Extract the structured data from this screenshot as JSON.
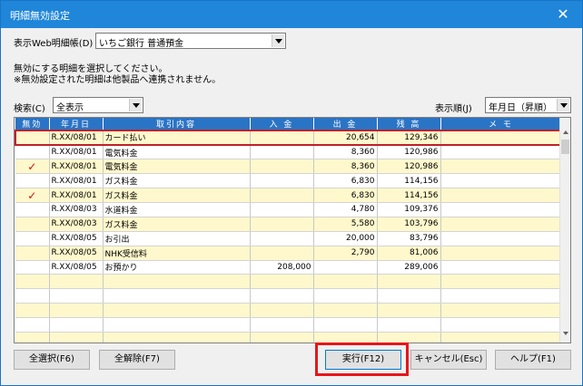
{
  "window": {
    "title": "明細無効設定",
    "close": "✕"
  },
  "account": {
    "label": "表示Web明細帳(D)",
    "value": "いちご銀行 普通預金"
  },
  "notes": [
    "無効にする明細を選択してください。",
    "※無効設定された明細は他製品へ連携されません。"
  ],
  "search": {
    "label": "検索(C)",
    "value": "全表示"
  },
  "sort": {
    "label": "表示順(J)",
    "value": "年月日（昇順）"
  },
  "table": {
    "columns": [
      "無効",
      "年月日",
      "取引内容",
      "入 金",
      "出 金",
      "残 高",
      "メ モ"
    ],
    "rows": [
      {
        "invalid": "",
        "date": "R.XX/08/01",
        "desc": "カード払い",
        "in": "",
        "out": "20,654",
        "balance": "129,346",
        "memo": ""
      },
      {
        "invalid": "",
        "date": "R.XX/08/01",
        "desc": "電気料金",
        "in": "",
        "out": "8,360",
        "balance": "120,986",
        "memo": ""
      },
      {
        "invalid": "✓",
        "date": "R.XX/08/01",
        "desc": "電気料金",
        "in": "",
        "out": "8,360",
        "balance": "120,986",
        "memo": ""
      },
      {
        "invalid": "",
        "date": "R.XX/08/01",
        "desc": "ガス料金",
        "in": "",
        "out": "6,830",
        "balance": "114,156",
        "memo": ""
      },
      {
        "invalid": "✓",
        "date": "R.XX/08/01",
        "desc": "ガス料金",
        "in": "",
        "out": "6,830",
        "balance": "114,156",
        "memo": ""
      },
      {
        "invalid": "",
        "date": "R.XX/08/03",
        "desc": "水道料金",
        "in": "",
        "out": "4,780",
        "balance": "109,376",
        "memo": ""
      },
      {
        "invalid": "",
        "date": "R.XX/08/03",
        "desc": "ガス料金",
        "in": "",
        "out": "5,580",
        "balance": "103,796",
        "memo": ""
      },
      {
        "invalid": "",
        "date": "R.XX/08/05",
        "desc": "お引出",
        "in": "",
        "out": "20,000",
        "balance": "83,796",
        "memo": ""
      },
      {
        "invalid": "",
        "date": "R.XX/08/05",
        "desc": "NHK受信料",
        "in": "",
        "out": "2,790",
        "balance": "81,006",
        "memo": ""
      },
      {
        "invalid": "",
        "date": "R.XX/08/05",
        "desc": "お預かり",
        "in": "208,000",
        "out": "",
        "balance": "289,006",
        "memo": ""
      },
      {
        "invalid": "",
        "date": "",
        "desc": "",
        "in": "",
        "out": "",
        "balance": "",
        "memo": ""
      },
      {
        "invalid": "",
        "date": "",
        "desc": "",
        "in": "",
        "out": "",
        "balance": "",
        "memo": ""
      },
      {
        "invalid": "",
        "date": "",
        "desc": "",
        "in": "",
        "out": "",
        "balance": "",
        "memo": ""
      },
      {
        "invalid": "",
        "date": "",
        "desc": "",
        "in": "",
        "out": "",
        "balance": "",
        "memo": ""
      },
      {
        "invalid": "",
        "date": "",
        "desc": "",
        "in": "",
        "out": "",
        "balance": "",
        "memo": ""
      }
    ]
  },
  "buttons": {
    "select_all": "全選択(F6)",
    "clear_all": "全解除(F7)",
    "execute": "実行(F12)",
    "cancel": "キャンセル(Esc)",
    "help": "ヘルプ(F1)"
  }
}
